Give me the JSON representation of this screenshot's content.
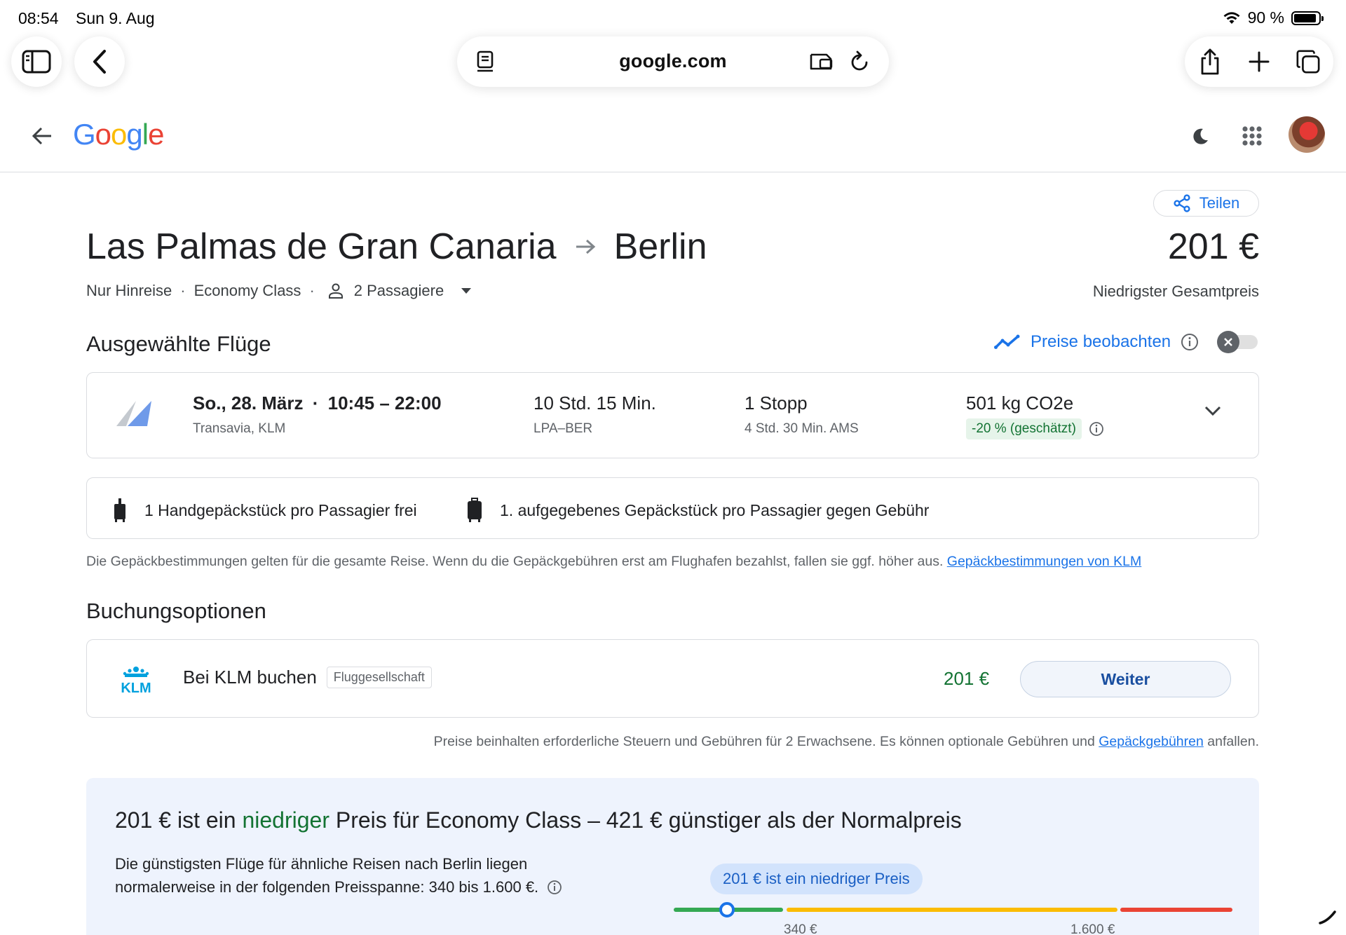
{
  "status_bar": {
    "time": "08:54",
    "date": "Sun 9. Aug",
    "battery": "90 %"
  },
  "browser": {
    "url": "google.com"
  },
  "route": {
    "origin": "Las Palmas de Gran Canaria",
    "destination": "Berlin"
  },
  "price": {
    "total": "201 €",
    "label": "Niedrigster Gesamtpreis"
  },
  "share_label": "Teilen",
  "trip_meta": {
    "trip_type": "Nur Hinreise",
    "cabin": "Economy Class",
    "passengers": "2 Passagiere"
  },
  "selected": {
    "title": "Ausgewählte Flüge",
    "track_prices": "Preise beobachten",
    "flight": {
      "date": "So., 28. März",
      "separator": "·",
      "times": "10:45 – 22:00",
      "airlines": "Transavia, KLM",
      "duration": "10 Std. 15 Min.",
      "airports": "LPA–BER",
      "stops": "1 Stopp",
      "layover": "4 Std. 30 Min. AMS",
      "emissions": "501 kg CO2e",
      "emissions_badge": "-20 % (geschätzt)"
    }
  },
  "baggage": {
    "carry_on": "1 Handgepäckstück pro Passagier frei",
    "checked": "1. aufgegebenes Gepäckstück pro Passagier gegen Gebühr",
    "note": "Die Gepäckbestimmungen gelten für die gesamte Reise. Wenn du die Gepäckgebühren erst am Flughafen bezahlst, fallen sie ggf. höher aus.",
    "link": "Gepäckbestimmungen von KLM"
  },
  "booking": {
    "title": "Buchungsoptionen",
    "provider_logo": "KLM",
    "label": "Bei KLM buchen",
    "tag": "Fluggesellschaft",
    "price": "201 €",
    "button": "Weiter",
    "note_before": "Preise beinhalten erforderliche Steuern und Gebühren für 2 Erwachsene. Es können optionale Gebühren und",
    "note_link": "Gepäckgebühren",
    "note_after": "anfallen."
  },
  "insight": {
    "title_prefix": "201 € ist ein",
    "title_highlight": "niedriger",
    "title_suffix": "Preis für Economy Class – 421 € günstiger als der Normalpreis",
    "body": "Die günstigsten Flüge für ähnliche Reisen nach Berlin liegen normalerweise in der folgenden Preisspanne: 340 bis 1.600 €.",
    "pill": "201 € ist ein niedriger Preis",
    "tick_low": "340 €",
    "tick_high": "1.600 €"
  },
  "colors": {
    "accent": "#1a73e8",
    "positive": "#137333",
    "bar_low": "#34a853",
    "bar_mid": "#fbbc04",
    "bar_high": "#ea4335"
  }
}
